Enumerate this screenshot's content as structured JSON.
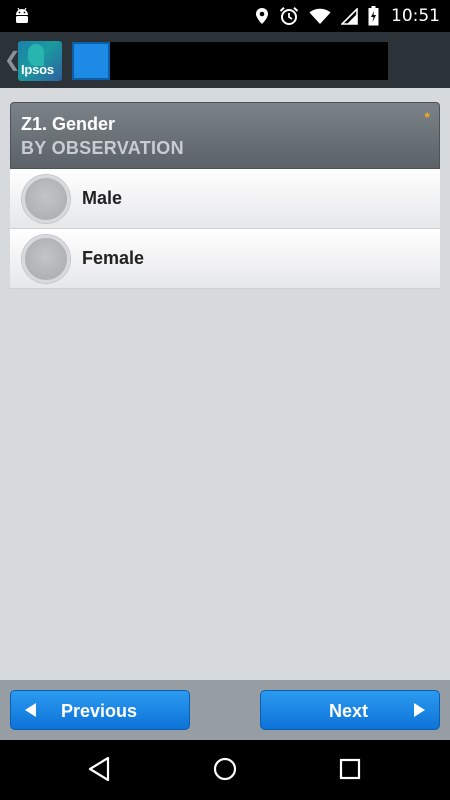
{
  "status_bar": {
    "time": "10:51",
    "icons": [
      "android-icon",
      "location-icon",
      "alarm-icon",
      "wifi-icon",
      "signal-icon",
      "battery-icon"
    ]
  },
  "action_bar": {
    "logo_text": "Ipsos",
    "icons": [
      "back-chevron-icon"
    ]
  },
  "question": {
    "title": "Z1. Gender",
    "subtitle": "BY OBSERVATION",
    "required_mark": "*",
    "options": [
      {
        "label": "Male",
        "selected": false
      },
      {
        "label": "Female",
        "selected": false
      }
    ]
  },
  "navigation": {
    "previous_label": "Previous",
    "next_label": "Next"
  },
  "system_nav": {
    "icons": [
      "back-icon",
      "home-icon",
      "recents-icon"
    ]
  },
  "colors": {
    "accent_blue": "#1d8ae6",
    "header_gray": "#6a7177",
    "required_orange": "#f5a623",
    "background": "#d7dadd"
  }
}
